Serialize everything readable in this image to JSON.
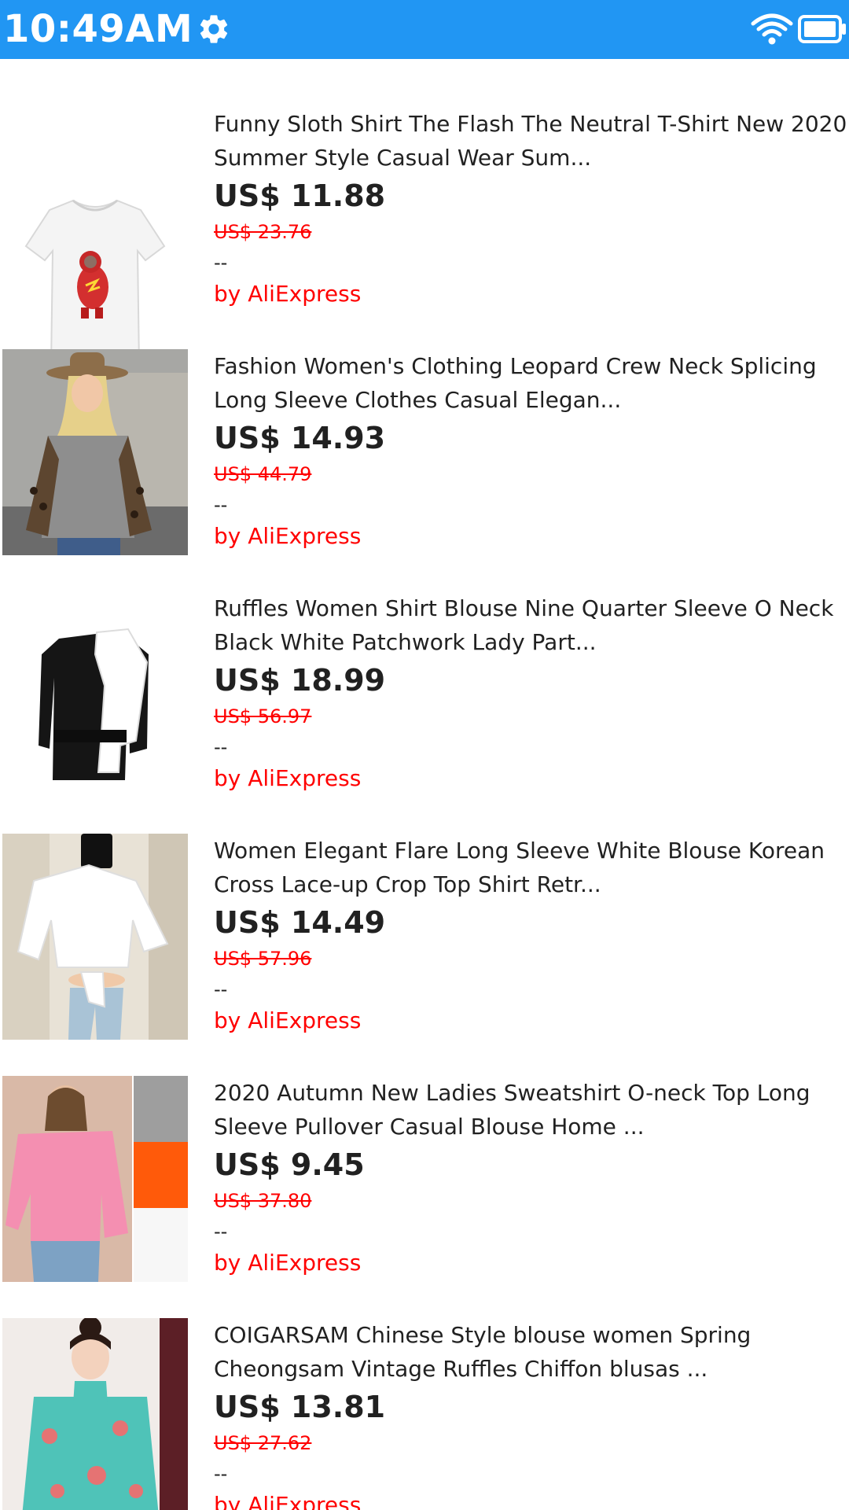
{
  "status_bar": {
    "time": "10:49AM",
    "icons": [
      "gear-icon",
      "wifi-icon",
      "battery-icon"
    ],
    "color": "#2196f3"
  },
  "products": [
    {
      "title": "Funny Sloth Shirt The Flash The Neutral T-Shirt New 2020 Summer Style Casual Wear Sum...",
      "price": "US$ 11.88",
      "old_price": "US$ 23.76",
      "rating": "--",
      "seller": "by AliExpress"
    },
    {
      "title": "Fashion Women's Clothing Leopard Crew Neck Splicing Long Sleeve Clothes Casual Elegan...",
      "price": "US$ 14.93",
      "old_price": "US$ 44.79",
      "rating": "--",
      "seller": "by AliExpress"
    },
    {
      "title": "Ruffles Women Shirt Blouse Nine Quarter Sleeve O Neck Black White Patchwork Lady Part...",
      "price": "US$ 18.99",
      "old_price": "US$ 56.97",
      "rating": "--",
      "seller": "by AliExpress"
    },
    {
      "title": "Women Elegant Flare Long Sleeve White Blouse Korean Cross Lace-up Crop Top Shirt Retr...",
      "price": "US$ 14.49",
      "old_price": "US$ 57.96",
      "rating": "--",
      "seller": "by AliExpress"
    },
    {
      "title": "2020 Autumn New Ladies Sweatshirt O-neck Top Long Sleeve Pullover Casual Blouse Home ...",
      "price": "US$ 9.45",
      "old_price": "US$ 37.80",
      "rating": "--",
      "seller": "by AliExpress"
    },
    {
      "title": "COIGARSAM Chinese Style blouse women Spring Cheongsam Vintage Ruffles Chiffon blusas ...",
      "price": "US$ 13.81",
      "old_price": "US$ 27.62",
      "rating": "--",
      "seller": "by AliExpress"
    }
  ],
  "colors": {
    "accent": "#2196f3",
    "sale": "#ff0000",
    "text": "#212121"
  }
}
